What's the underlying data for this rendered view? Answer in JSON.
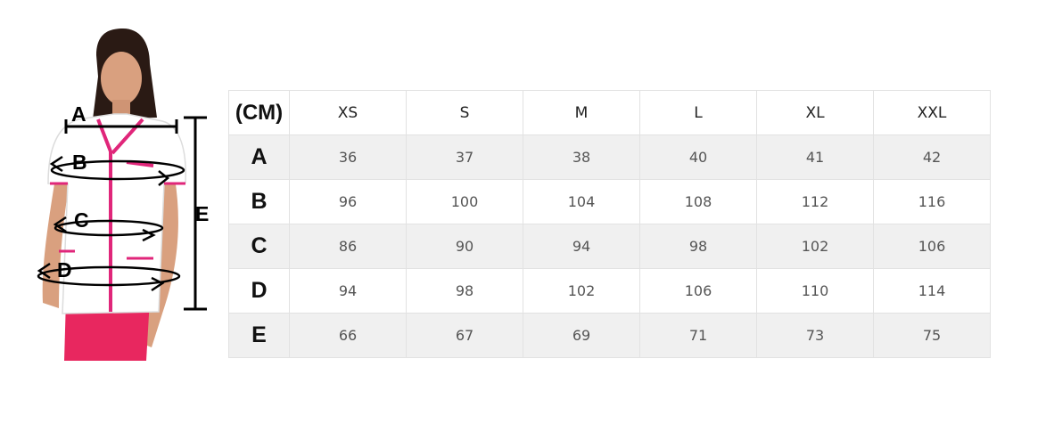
{
  "measure_labels": {
    "a": "A",
    "b": "B",
    "c": "C",
    "d": "D",
    "e": "E"
  },
  "colors": {
    "tunic": "#ffffff",
    "trim": "#e0267a",
    "trousers": "#e8275f",
    "hair": "#2a1a14",
    "skin": "#d9a07f",
    "guide_lines": "#000000"
  },
  "table": {
    "unit": "(CM)",
    "sizes": [
      "XS",
      "S",
      "M",
      "L",
      "XL",
      "XXL"
    ],
    "rows": [
      {
        "label": "A",
        "values": [
          "36",
          "37",
          "38",
          "40",
          "41",
          "42"
        ]
      },
      {
        "label": "B",
        "values": [
          "96",
          "100",
          "104",
          "108",
          "112",
          "116"
        ]
      },
      {
        "label": "C",
        "values": [
          "86",
          "90",
          "94",
          "98",
          "102",
          "106"
        ]
      },
      {
        "label": "D",
        "values": [
          "94",
          "98",
          "102",
          "106",
          "110",
          "114"
        ]
      },
      {
        "label": "E",
        "values": [
          "66",
          "67",
          "69",
          "71",
          "73",
          "75"
        ]
      }
    ]
  }
}
